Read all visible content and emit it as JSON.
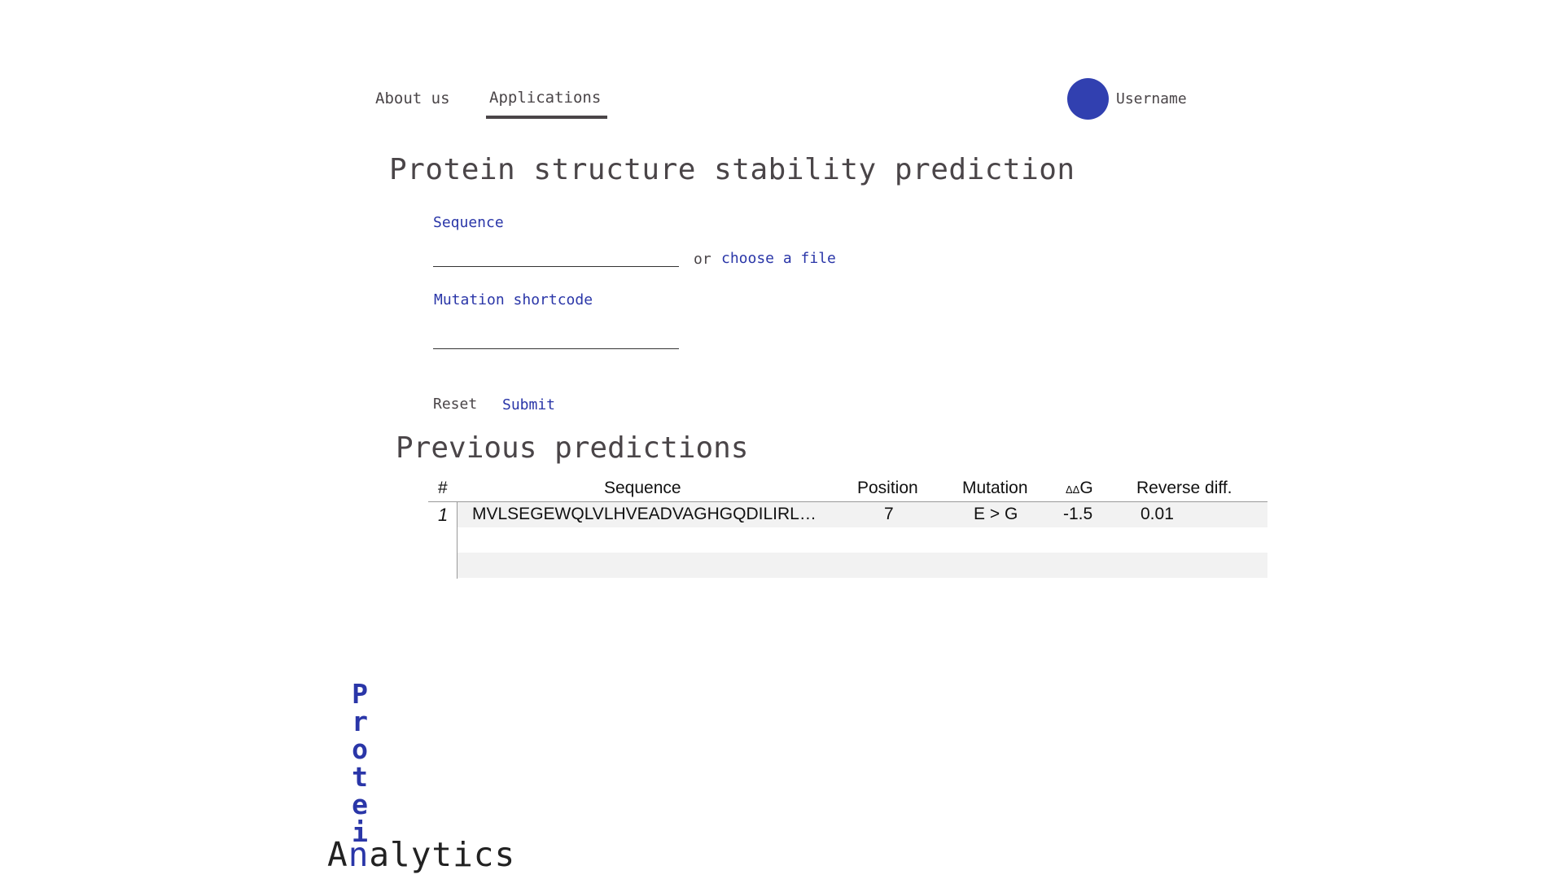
{
  "nav": {
    "about": "About us",
    "applications": "Applications",
    "username": "Username"
  },
  "page_title": "Protein structure stability prediction",
  "form": {
    "sequence_label": "Sequence",
    "sequence_value": "",
    "or_text": "or",
    "choose_file": "choose a file",
    "mutation_label": "Mutation shortcode",
    "mutation_value": "",
    "reset": "Reset",
    "submit": "Submit"
  },
  "predictions": {
    "title": "Previous predictions",
    "columns": {
      "num": "#",
      "sequence": "Sequence",
      "position": "Position",
      "mutation": "Mutation",
      "ddg_prefix": "ΔΔ",
      "ddg_suffix": "G",
      "reverse": "Reverse diff."
    },
    "rows": [
      {
        "num": "1",
        "sequence": "MVLSEGEWQLVLHVEADVAGHGQDILIRLFKSHPETLEKF",
        "position": "7",
        "mutation": "E > G",
        "ddg": "-1.5",
        "reverse": "0.01"
      }
    ]
  },
  "logo": {
    "vertical": [
      "P",
      "r",
      "o",
      "t",
      "e",
      "i"
    ],
    "first": "A",
    "shared": "n",
    "rest": "alytics"
  },
  "colors": {
    "accent": "#2a36a8",
    "avatar": "#3140b0",
    "text": "#4a4548"
  }
}
